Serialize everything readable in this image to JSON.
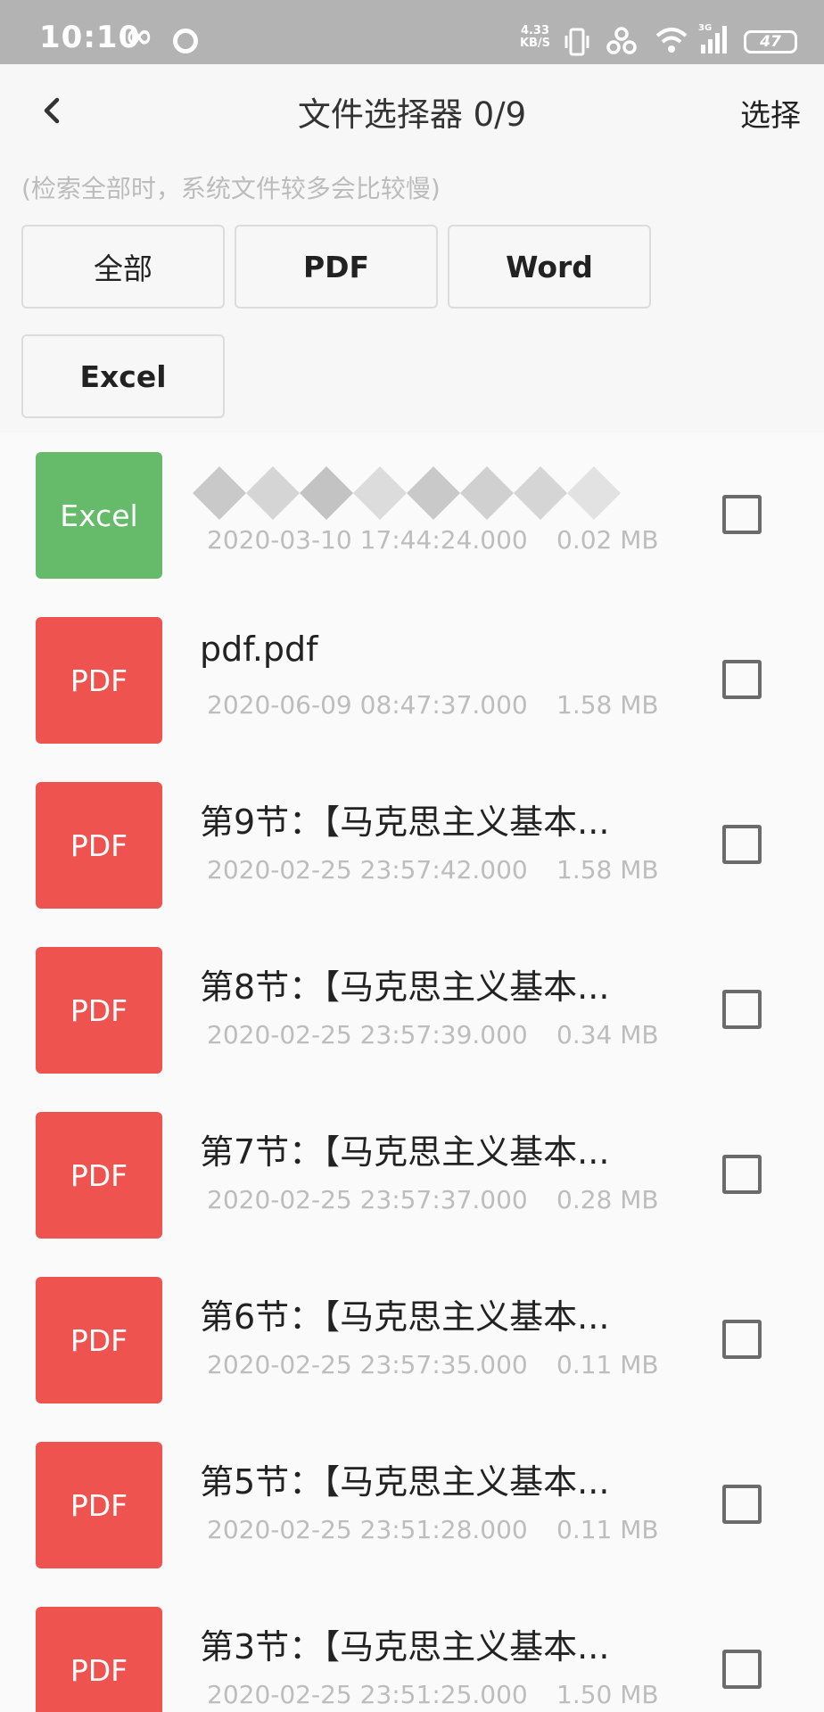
{
  "status_bar": {
    "time": "10:10",
    "infinity_symbol": "∞",
    "net_speed": "4.33",
    "net_speed_unit": "KB/S",
    "network_type": "3G",
    "battery": "47",
    "icons": [
      "infinity-icon",
      "circle-icon",
      "vibrate-icon",
      "link-icon",
      "wifi-icon",
      "signal-icon",
      "battery-icon"
    ]
  },
  "header": {
    "title": "文件选择器 0/9",
    "select_label": "选择",
    "back_icon": "chevron-left-icon"
  },
  "hint": "(检索全部时，系统文件较多会比较慢)",
  "filters": [
    "全部",
    "PDF",
    "Word",
    "Excel"
  ],
  "colors": {
    "pdf_badge": "#ef5350",
    "excel_badge": "#66bb6a",
    "status_bar": "#b3b3b3"
  },
  "files": [
    {
      "type": "Excel",
      "name": "",
      "date": "2020-03-10 17:44:24.000",
      "size": "0.02 MB",
      "redacted_name": true
    },
    {
      "type": "PDF",
      "name": "pdf.pdf",
      "date": "2020-06-09 08:47:37.000",
      "size": "1.58 MB"
    },
    {
      "type": "PDF",
      "name": "第9节：【马克思主义基本...",
      "date": "2020-02-25 23:57:42.000",
      "size": "1.58 MB"
    },
    {
      "type": "PDF",
      "name": "第8节：【马克思主义基本...",
      "date": "2020-02-25 23:57:39.000",
      "size": "0.34 MB"
    },
    {
      "type": "PDF",
      "name": "第7节：【马克思主义基本...",
      "date": "2020-02-25 23:57:37.000",
      "size": "0.28 MB"
    },
    {
      "type": "PDF",
      "name": "第6节：【马克思主义基本...",
      "date": "2020-02-25 23:57:35.000",
      "size": "0.11 MB"
    },
    {
      "type": "PDF",
      "name": "第5节：【马克思主义基本...",
      "date": "2020-02-25 23:51:28.000",
      "size": "0.11 MB"
    },
    {
      "type": "PDF",
      "name": "第3节：【马克思主义基本...",
      "date": "2020-02-25 23:51:25.000",
      "size": "1.50 MB"
    }
  ]
}
